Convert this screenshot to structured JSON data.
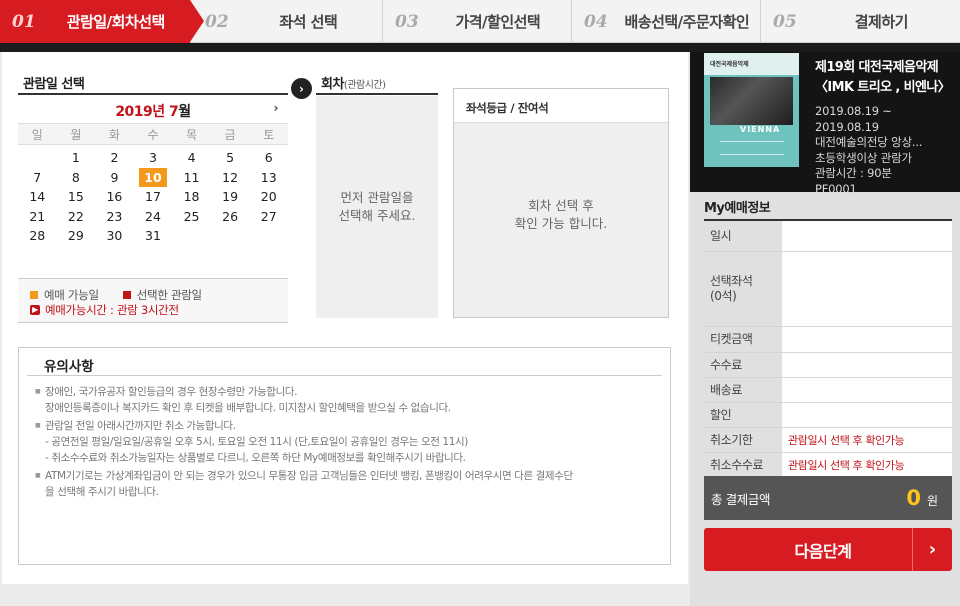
{
  "steps": [
    {
      "num": "01",
      "label": "관람일/회차선택",
      "active": true
    },
    {
      "num": "02",
      "label": "좌석 선택"
    },
    {
      "num": "03",
      "label": "가격/할인선택"
    },
    {
      "num": "04",
      "label": "배송선택/주문자확인"
    },
    {
      "num": "05",
      "label": "결제하기"
    }
  ],
  "calendar": {
    "title": "관람일 선택",
    "year_text": "2019년",
    "month_num": "7",
    "month_suffix": "월",
    "next_icon": "chevron-right-icon",
    "weekdays": [
      "일",
      "월",
      "화",
      "수",
      "목",
      "금",
      "토"
    ],
    "days": [
      "",
      "1",
      "2",
      "3",
      "4",
      "5",
      "6",
      "7",
      "8",
      "9",
      "10",
      "11",
      "12",
      "13",
      "14",
      "15",
      "16",
      "17",
      "18",
      "19",
      "20",
      "21",
      "22",
      "23",
      "24",
      "25",
      "26",
      "27",
      "28",
      "29",
      "30",
      "31",
      "",
      "",
      ""
    ],
    "selected_day": "10",
    "legend_available": "예매 가능일",
    "legend_selected": "선택한 관람일",
    "legend_deadline": "예매가능시간 : 관람 3시간전",
    "colors": {
      "available": "#f39a1d",
      "selected": "#c0131a"
    }
  },
  "session": {
    "title": "회차",
    "subtitle": "(관람시간)",
    "placeholder": "먼저 관람일을\n선택해 주세요."
  },
  "seat": {
    "title": "좌석등급 / 잔여석",
    "placeholder": "회차 선택 후\n확인 가능 합니다."
  },
  "notice": {
    "title": "유의사항",
    "items": [
      "장애인, 국가유공자 할인등급의 경우 현장수령만 가능합니다.\n장애인등록증이나 복지카드 확인 후 티켓을 배부합니다. 미지참시 할인혜택을 받으실 수 없습니다.",
      "관람일 전일 아래시간까지만 취소 가능합니다.\n- 공연전일 평일/일요일/공휴일 오후 5시, 토요일 오전 11시 (단,토요일이 공휴일인 경우는 오전 11시)\n- 취소수수료와 취소가능일자는 상품별로 다르니, 오른쪽 하단 My예매정보를 확인해주시기 바랍니다.",
      "ATM기기로는 가상계좌입금이 안 되는 경우가 있으니 무통장 입금 고객님들은 인터넷 뱅킹, 폰뱅킹이 어려우시면 다른 결제수단\n을 선택해 주시기 바랍니다."
    ]
  },
  "performance": {
    "title": "제19회 대전국제음악제 〈IMK 트리오 , 비엔나〉",
    "poster_text": "VIENNA",
    "poster_header": "대전국제음악제",
    "date_line1": "2019.08.19 ~",
    "date_line2": "2019.08.19",
    "venue": "대전예술의전당 앙상...",
    "age": "초등학생이상 관람가",
    "runtime": "관람시간 : 90분",
    "code": "PF0001"
  },
  "my_booking": {
    "title": "My예매정보",
    "rows": [
      {
        "label": "일시",
        "value": ""
      },
      {
        "label": "선택좌석\n(0석)",
        "value": ""
      },
      {
        "label": "티켓금액",
        "value": ""
      },
      {
        "label": "수수료",
        "value": ""
      },
      {
        "label": "배송료",
        "value": ""
      },
      {
        "label": "할인",
        "value": ""
      },
      {
        "label": "취소기한",
        "value": "관람일시 선택 후 확인가능"
      },
      {
        "label": "취소수수료",
        "value": "관람일시 선택 후 확인가능"
      }
    ],
    "total_label": "총 결제금액",
    "total_amount": "0",
    "total_unit": "원"
  },
  "next_button": {
    "label": "다음단계",
    "icon": "chevron-right-icon"
  },
  "colors": {
    "accent": "#d61b21",
    "highlight": "#f39a1d",
    "total_amount": "#ffc31f"
  }
}
